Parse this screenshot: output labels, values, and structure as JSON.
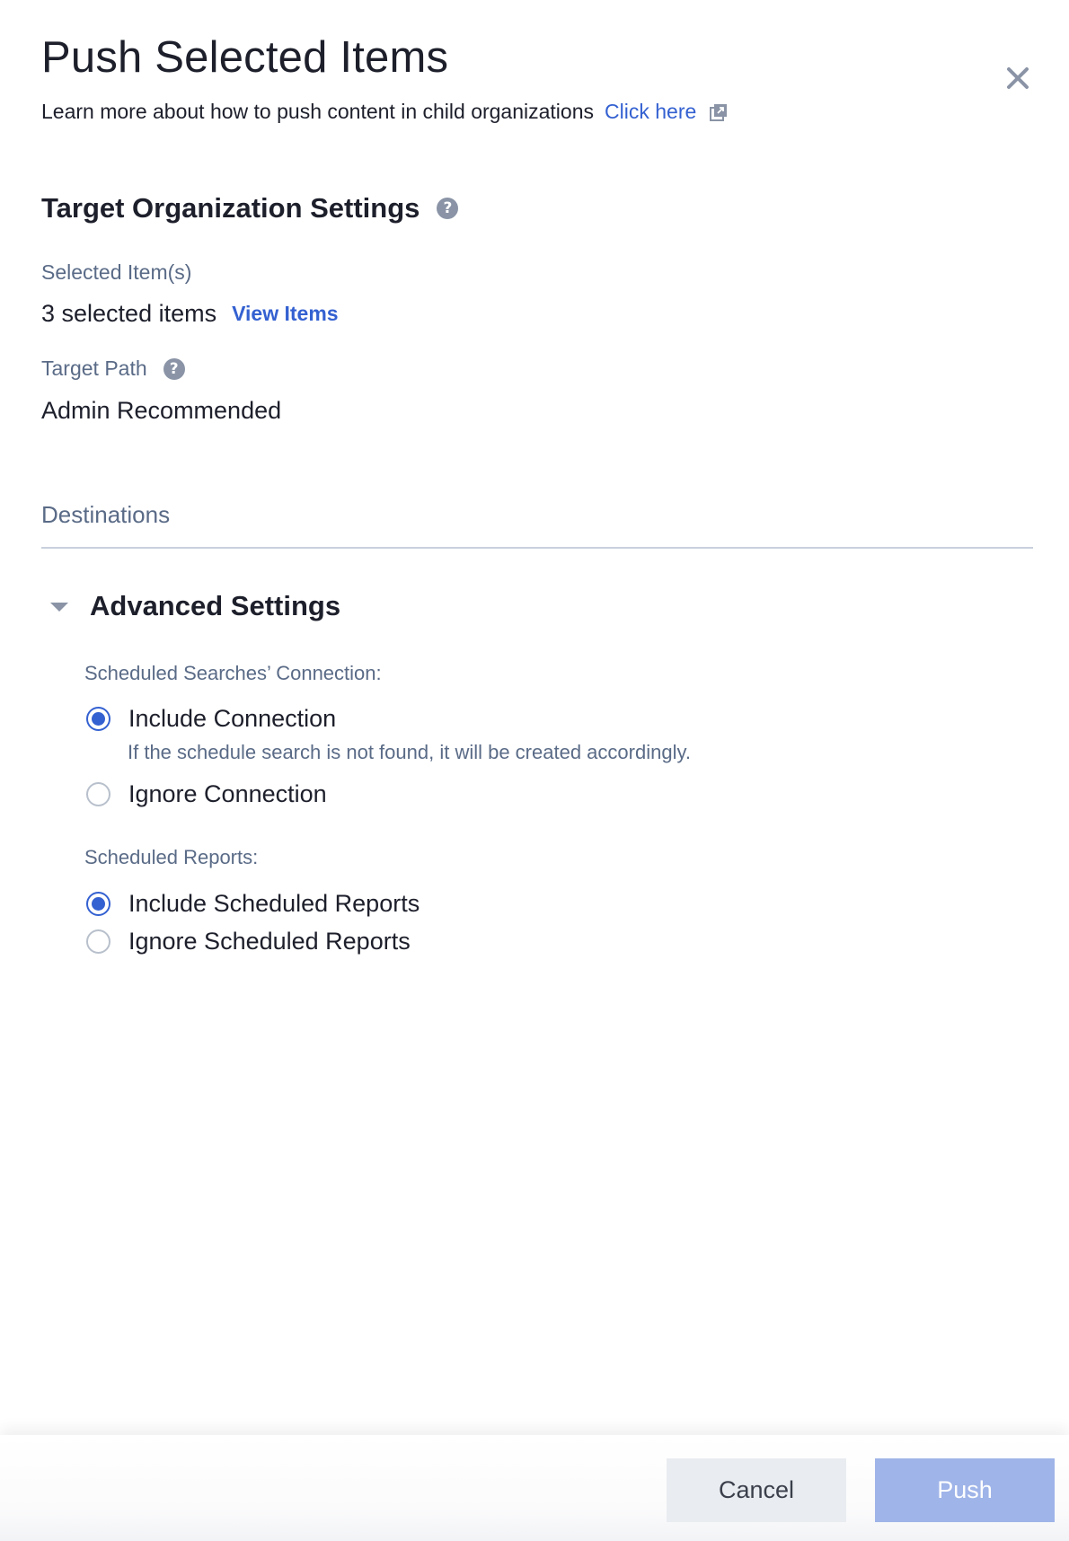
{
  "dialog": {
    "title": "Push Selected Items",
    "learn_more_text": "Learn more about how to push content in child organizations",
    "learn_more_link": "Click here"
  },
  "target_settings": {
    "section_title": "Target Organization Settings",
    "selected_items_label": "Selected Item(s)",
    "selected_items_value": "3 selected items",
    "view_items_link": "View Items",
    "target_path_label": "Target Path",
    "target_path_value": "Admin Recommended"
  },
  "destinations": {
    "label": "Destinations"
  },
  "advanced": {
    "title": "Advanced Settings",
    "expanded": true,
    "searches_group": {
      "label": "Scheduled Searches’ Connection:",
      "options": [
        {
          "label": "Include Connection",
          "checked": true,
          "help": "If the schedule search is not found, it will be created accordingly."
        },
        {
          "label": "Ignore Connection",
          "checked": false
        }
      ]
    },
    "reports_group": {
      "label": "Scheduled Reports:",
      "options": [
        {
          "label": "Include Scheduled Reports",
          "checked": true
        },
        {
          "label": "Ignore Scheduled Reports",
          "checked": false
        }
      ]
    }
  },
  "footer": {
    "cancel_label": "Cancel",
    "push_label": "Push"
  },
  "colors": {
    "accent": "#3461d1",
    "push_disabled": "#9fb4e8",
    "muted_text": "#5a6b87"
  },
  "icons": {
    "close": "close-icon",
    "external_link": "external-link-icon",
    "help": "help-icon",
    "caret": "caret-down-icon"
  }
}
